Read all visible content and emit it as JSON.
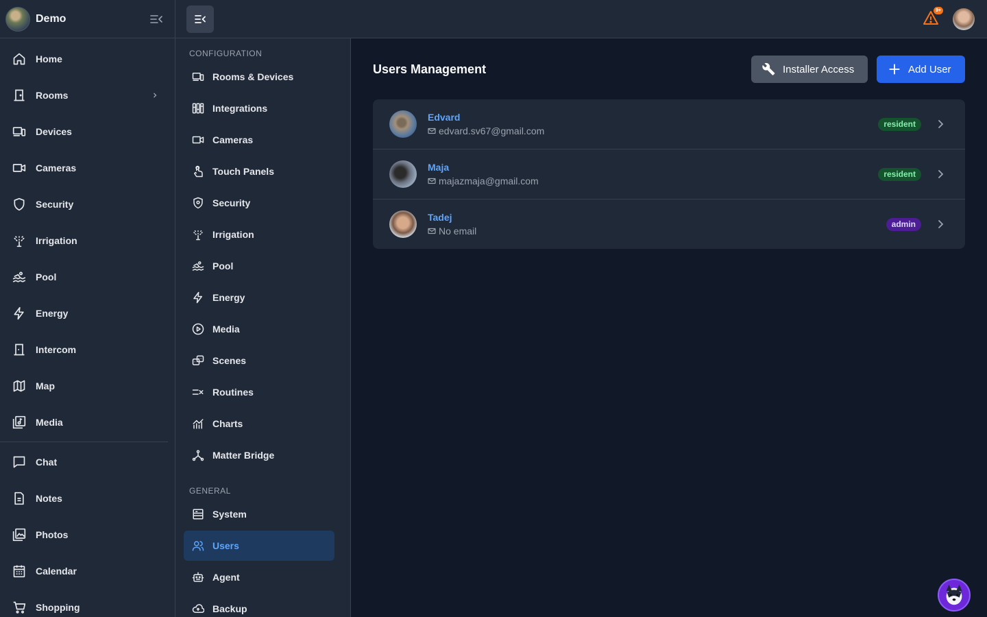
{
  "brand": {
    "name": "Demo"
  },
  "nav": [
    {
      "label": "Home",
      "icon": "home-icon"
    },
    {
      "label": "Rooms",
      "icon": "door-icon",
      "has_submenu": true
    },
    {
      "label": "Devices",
      "icon": "devices-icon"
    },
    {
      "label": "Cameras",
      "icon": "video-icon"
    },
    {
      "label": "Security",
      "icon": "shield-icon"
    },
    {
      "label": "Irrigation",
      "icon": "sprinkler-icon"
    },
    {
      "label": "Pool",
      "icon": "pool-icon"
    },
    {
      "label": "Energy",
      "icon": "bolt-icon"
    },
    {
      "label": "Intercom",
      "icon": "intercom-icon"
    },
    {
      "label": "Map",
      "icon": "map-icon"
    },
    {
      "label": "Media",
      "icon": "media-library-icon"
    }
  ],
  "nav2": [
    {
      "label": "Chat",
      "icon": "chat-icon"
    },
    {
      "label": "Notes",
      "icon": "notes-icon"
    },
    {
      "label": "Photos",
      "icon": "photos-icon"
    },
    {
      "label": "Calendar",
      "icon": "calendar-icon"
    },
    {
      "label": "Shopping",
      "icon": "cart-icon"
    }
  ],
  "topbar": {
    "notification_badge": "9+"
  },
  "config": {
    "section_configuration": "CONFIGURATION",
    "section_general": "GENERAL",
    "configuration_items": [
      {
        "label": "Rooms & Devices",
        "icon": "rooms-devices-icon"
      },
      {
        "label": "Integrations",
        "icon": "integrations-icon"
      },
      {
        "label": "Cameras",
        "icon": "video-icon"
      },
      {
        "label": "Touch Panels",
        "icon": "touch-icon"
      },
      {
        "label": "Security",
        "icon": "shield-icon"
      },
      {
        "label": "Irrigation",
        "icon": "sprinkler-icon"
      },
      {
        "label": "Pool",
        "icon": "pool-icon"
      },
      {
        "label": "Energy",
        "icon": "bolt-icon"
      },
      {
        "label": "Media",
        "icon": "play-circle-icon"
      },
      {
        "label": "Scenes",
        "icon": "scenes-icon"
      },
      {
        "label": "Routines",
        "icon": "routines-icon"
      },
      {
        "label": "Charts",
        "icon": "chart-icon"
      },
      {
        "label": "Matter Bridge",
        "icon": "network-icon"
      }
    ],
    "general_items": [
      {
        "label": "System",
        "icon": "server-icon"
      },
      {
        "label": "Users",
        "icon": "users-icon",
        "active": true
      },
      {
        "label": "Agent",
        "icon": "robot-icon"
      },
      {
        "label": "Backup",
        "icon": "cloud-icon"
      }
    ]
  },
  "main": {
    "title": "Users Management",
    "installer_button": "Installer Access",
    "add_user_button": "Add User",
    "users": [
      {
        "name": "Edvard",
        "email": "edvard.sv67@gmail.com",
        "role": "resident"
      },
      {
        "name": "Maja",
        "email": "majazmaja@gmail.com",
        "role": "resident"
      },
      {
        "name": "Tadej",
        "email": "No email",
        "role": "admin"
      }
    ]
  },
  "colors": {
    "background": "#111827",
    "panel": "#1f2937",
    "accent": "#2563eb",
    "link": "#60a5fa",
    "resident_badge": "#14532d",
    "admin_badge": "#4c1d95",
    "alert": "#f97316"
  }
}
